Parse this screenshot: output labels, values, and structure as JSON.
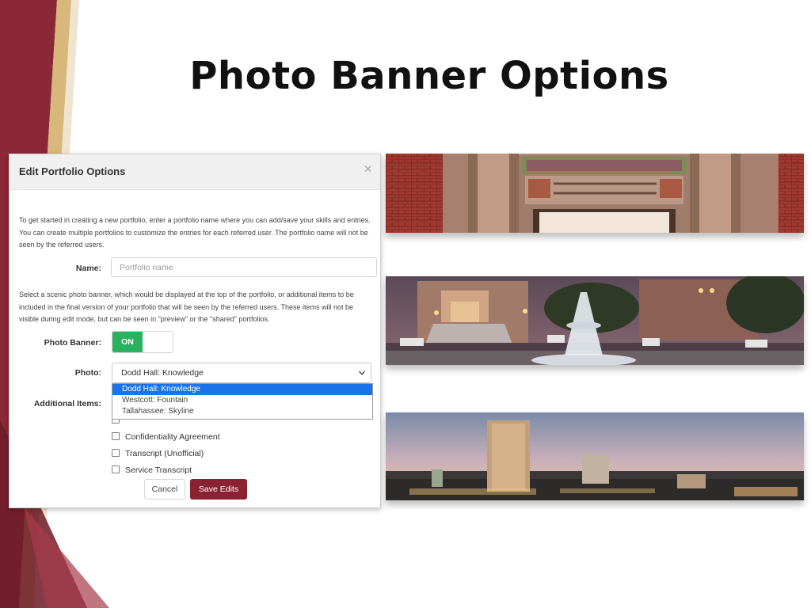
{
  "slide": {
    "title": "Photo Banner Options"
  },
  "modal": {
    "title": "Edit Portfolio Options",
    "close_icon": "close-icon",
    "intro_text": "To get started in creating a new portfolio, enter a portfolio name where you can add/save your skills and entries. You can create multiple portfolios to customize the entries for each referred user. The portfolio name will not be seen by the referred users.",
    "name_label": "Name:",
    "name_placeholder": "Portfolio name",
    "banner_text": "Select a scenic photo banner, which would be displayed at the top of the portfolio, or additional items to be included in the final version of your portfolio that will be seen by the referred users. These items will not be visible during edit mode, but can be seen in \"preview\" or the \"shared\" portfolios.",
    "photo_banner_label": "Photo Banner:",
    "toggle_on_label": "ON",
    "photo_label": "Photo:",
    "photo_selected": "Dodd Hall: Knowledge",
    "photo_options": [
      "Dodd Hall: Knowledge",
      "Westcott: Fountain",
      "Tallahassee: Skyline"
    ],
    "additional_items_label": "Additional Items:",
    "additional_items": [
      "",
      "Confidentiality Agreement",
      "Transcript (Unofficial)",
      "Service Transcript"
    ],
    "cancel_label": "Cancel",
    "save_label": "Save Edits"
  },
  "banners": [
    {
      "name": "Dodd Hall: Knowledge"
    },
    {
      "name": "Westcott: Fountain"
    },
    {
      "name": "Tallahassee: Skyline"
    }
  ],
  "colors": {
    "accent": "#8b2232",
    "toggle_on": "#2bb260",
    "selected_option": "#1a73e8",
    "deco_dark": "#8b2838",
    "deco_gold": "#d8b77a"
  }
}
